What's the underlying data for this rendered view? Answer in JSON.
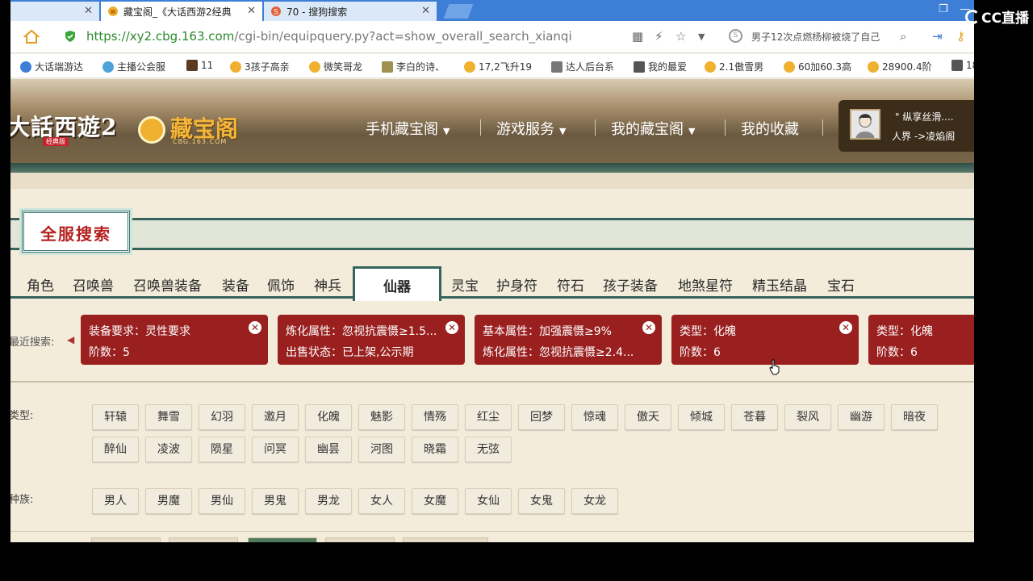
{
  "browser": {
    "tabs": [
      {
        "label": "",
        "active": false
      },
      {
        "label": "藏宝阁_《大话西游2经典",
        "active": true
      },
      {
        "label": "70 - 搜狗搜索",
        "active": false
      }
    ],
    "url_host": "https://xy2.cbg.163.com",
    "url_path": "/cgi-bin/equipquery.py?act=show_overall_search_xianqi",
    "search_text": "男子12次点燃杨柳被烧了自己",
    "bookmarks": [
      "大话端游达",
      "主播公会服",
      "11",
      "3孩子高亲",
      "微笑哥龙",
      "李白的诗、",
      "17,2飞升19",
      "达人后台系",
      "我的最爱",
      "2.1傲雪男",
      "60加60.3高",
      "28900.4阶",
      "18"
    ]
  },
  "site": {
    "game_logo": "大話西遊2",
    "game_logo_sub": "经典版",
    "cbg_logo": "藏宝阁",
    "cbg_logo_sub": "CBG.163.COM",
    "nav": [
      "手机藏宝阁",
      "游戏服务",
      "我的藏宝阁",
      "我的收藏"
    ],
    "user_name": "\" 纵享丝滑....",
    "user_server": "人界 ->凌焰阁",
    "page_title": "全服搜索",
    "categories": [
      "角色",
      "召唤兽",
      "召唤兽装备",
      "装备",
      "佩饰",
      "神兵",
      "仙器",
      "灵宝",
      "护身符",
      "符石",
      "孩子装备",
      "地煞星符",
      "精玉结晶",
      "宝石"
    ],
    "active_category": "仙器",
    "recent_label": "最近搜索:",
    "recent": [
      {
        "l1": "装备要求：灵性要求",
        "l2": "阶数：5"
      },
      {
        "l1": "炼化属性：忽视抗震慑≥1.5...",
        "l2": "出售状态：已上架,公示期"
      },
      {
        "l1": "基本属性：加强震慑≥9%",
        "l2": "炼化属性：忽视抗震慑≥2.4..."
      },
      {
        "l1": "类型：化魄",
        "l2": "阶数：6"
      },
      {
        "l1": "类型：化魄",
        "l2": "阶数：6"
      }
    ],
    "type_label": "类型:",
    "types": [
      "轩辕",
      "舞雪",
      "幻羽",
      "邀月",
      "化魄",
      "魅影",
      "情殇",
      "红尘",
      "回梦",
      "惊魂",
      "傲天",
      "倾城",
      "苍暮",
      "裂风",
      "幽游",
      "暗夜",
      "醉仙",
      "凌波",
      "陨星",
      "问冥",
      "幽昙",
      "河图",
      "晓霜",
      "无弦"
    ],
    "race_label": "种族:",
    "races": [
      "男人",
      "男魔",
      "男仙",
      "男鬼",
      "男龙",
      "女人",
      "女魔",
      "女仙",
      "女鬼",
      "女龙"
    ]
  },
  "watermark": "CC直播",
  "colors": {
    "accent_red": "#9a1f1f",
    "teal": "#35645d",
    "url_green": "#2b8a2b"
  }
}
